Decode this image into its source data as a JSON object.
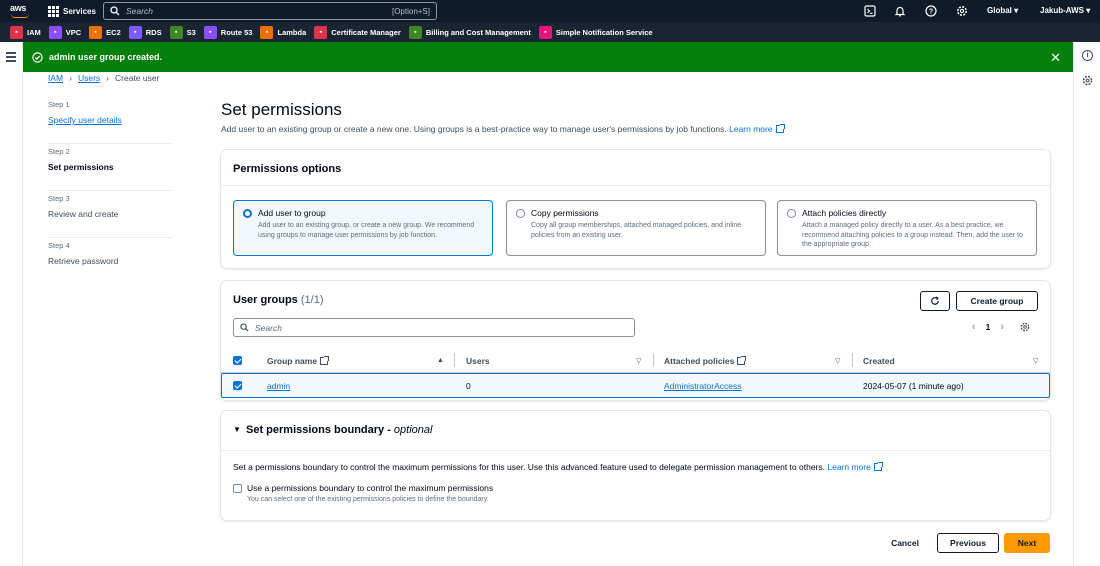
{
  "topbar": {
    "logo_text": "aws",
    "services_label": "Services",
    "search_placeholder": "Search",
    "search_shortcut": "[Option+S]",
    "region": "Global",
    "account": "Jakub-AWS"
  },
  "favorites": [
    {
      "label": "IAM",
      "color": "#dd344c"
    },
    {
      "label": "VPC",
      "color": "#8c4fff"
    },
    {
      "label": "EC2",
      "color": "#ed7100"
    },
    {
      "label": "RDS",
      "color": "#7b5cff"
    },
    {
      "label": "S3",
      "color": "#3f8624"
    },
    {
      "label": "Route 53",
      "color": "#8c4fff"
    },
    {
      "label": "Lambda",
      "color": "#ed7100"
    },
    {
      "label": "Certificate Manager",
      "color": "#dd344c"
    },
    {
      "label": "Billing and Cost Management",
      "color": "#3f8624"
    },
    {
      "label": "Simple Notification Service",
      "color": "#e7157b"
    }
  ],
  "flash": {
    "message": "admin user group created."
  },
  "breadcrumbs": [
    "IAM",
    "Users",
    "Create user"
  ],
  "steps": [
    {
      "num": "Step 1",
      "label": "Specify user details"
    },
    {
      "num": "Step 2",
      "label": "Set permissions"
    },
    {
      "num": "Step 3",
      "label": "Review and create"
    },
    {
      "num": "Step 4",
      "label": "Retrieve password"
    }
  ],
  "page": {
    "title": "Set permissions",
    "description": "Add user to an existing group or create a new one. Using groups is a best-practice way to manage user's permissions by job functions.",
    "learn_more": "Learn more"
  },
  "permissions_options": {
    "title": "Permissions options",
    "options": [
      {
        "title": "Add user to group",
        "desc": "Add user to an existing group, or create a new group. We recommend using groups to manage user permissions by job function.",
        "selected": true
      },
      {
        "title": "Copy permissions",
        "desc": "Copy all group memberships, attached managed policies, and inline policies from an existing user.",
        "selected": false
      },
      {
        "title": "Attach policies directly",
        "desc": "Attach a managed policy directly to a user. As a best practice, we recommend attaching policies to a group instead. Then, add the user to the appropriate group.",
        "selected": false
      }
    ]
  },
  "user_groups": {
    "title": "User groups",
    "count": "(1/1)",
    "create_label": "Create group",
    "search_placeholder": "Search",
    "page": "1",
    "columns": [
      "Group name",
      "Users",
      "Attached policies",
      "Created"
    ],
    "rows": [
      {
        "name": "admin",
        "users": "0",
        "policies": "AdministratorAccess",
        "created": "2024-05-07 (1 minute ago)",
        "checked": true
      }
    ]
  },
  "boundary": {
    "title": "Set permissions boundary - ",
    "title_optional": "optional",
    "description": "Set a permissions boundary to control the maximum permissions for this user. Use this advanced feature used to delegate permission management to others.",
    "learn_more": "Learn more",
    "checkbox_label": "Use a permissions boundary to control the maximum permissions",
    "checkbox_desc": "You can select one of the existing permissions policies to define the boundary."
  },
  "footer": {
    "cancel": "Cancel",
    "previous": "Previous",
    "next": "Next"
  }
}
